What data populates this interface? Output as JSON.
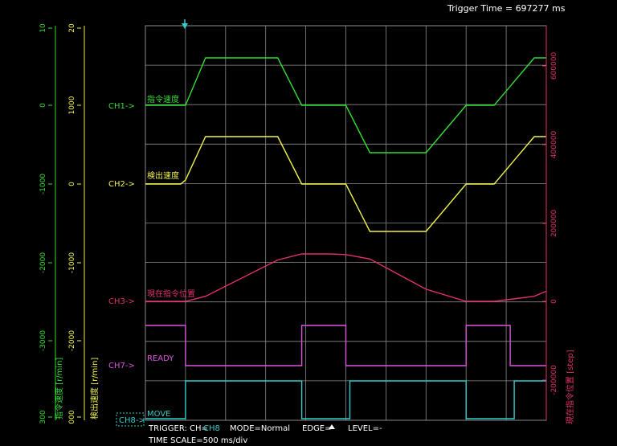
{
  "header": {
    "trigger_time": "Trigger Time = 697277 ms"
  },
  "colors": {
    "ch1": "#33dd33",
    "ch2": "#f2f24a",
    "ch3": "#e0306a",
    "ch7": "#dd55dd",
    "ch8": "#33cccc",
    "grid": "#8a8a8a"
  },
  "status": {
    "trigger_label": "TRIGGER: CH=",
    "trigger_ch": "CH8",
    "mode": "MODE=Normal",
    "edge_label": "EDGE=",
    "edge_icon": "rising-edge-icon",
    "level": "LEVEL=-",
    "time_scale": "TIME SCALE=500 ms/div"
  },
  "chart_data": {
    "type": "line",
    "x_unit": "ms",
    "x_range": [
      -500,
      4500
    ],
    "x_divisions": 10,
    "axes": {
      "ch1_speed": {
        "label": "指令速度 [r/min]",
        "ticks": [
          "10",
          "0",
          "-1000",
          "-2000",
          "-3000",
          "300"
        ]
      },
      "ch2_speed": {
        "label": "検出速度 [r/min]",
        "ticks": [
          "20",
          "1000",
          "0",
          "-1000",
          "-2000",
          "000"
        ]
      },
      "ch3_position": {
        "label": "現在指令位置 [step]",
        "ticks": [
          "600000",
          "400000",
          "200000",
          "0",
          "-200000"
        ]
      }
    },
    "channel_labels": [
      {
        "id": "CH1",
        "marker": "CH1->",
        "name": "指令速度"
      },
      {
        "id": "CH2",
        "marker": "CH2->",
        "name": "検出速度"
      },
      {
        "id": "CH3",
        "marker": "CH3->",
        "name": "現在指令位置"
      },
      {
        "id": "CH7",
        "marker": "CH7->",
        "name": "READY"
      },
      {
        "id": "CH8",
        "marker": "CH8->",
        "name": "MOVE"
      }
    ],
    "series": [
      {
        "name": "指令速度",
        "channel": "CH1",
        "unit": "r/min",
        "x": [
          -500,
          0,
          250,
          1150,
          1450,
          2000,
          2300,
          3000,
          3500,
          3850,
          4350,
          4500
        ],
        "y": [
          0,
          0,
          1200,
          1200,
          0,
          0,
          -1200,
          -1200,
          0,
          0,
          1200,
          1200
        ]
      },
      {
        "name": "検出速度",
        "channel": "CH2",
        "unit": "r/min",
        "x": [
          -500,
          -60,
          0,
          250,
          1150,
          1450,
          2000,
          2300,
          3000,
          3500,
          3850,
          4350,
          4500
        ],
        "y": [
          0,
          0,
          100,
          1200,
          1200,
          0,
          0,
          -1200,
          -1200,
          0,
          0,
          1200,
          1200
        ]
      },
      {
        "name": "現在指令位置",
        "channel": "CH3",
        "unit": "step",
        "x": [
          -500,
          0,
          250,
          1150,
          1450,
          1800,
          2000,
          2300,
          3000,
          3500,
          3850,
          4350,
          4500
        ],
        "y": [
          0,
          0,
          25000,
          205000,
          235000,
          235000,
          232000,
          210000,
          60000,
          0,
          0,
          25000,
          50000
        ]
      },
      {
        "name": "READY",
        "channel": "CH7",
        "unit": "logic",
        "x": [
          -500,
          0,
          0,
          1450,
          1450,
          2000,
          2000,
          3500,
          3500,
          4050,
          4050,
          4500
        ],
        "y": [
          1,
          1,
          0,
          0,
          1,
          1,
          0,
          0,
          1,
          1,
          0,
          0
        ]
      },
      {
        "name": "MOVE",
        "channel": "CH8",
        "unit": "logic",
        "x": [
          -500,
          0,
          0,
          1450,
          1450,
          2050,
          2050,
          3500,
          3500,
          4100,
          4100,
          4500
        ],
        "y": [
          0,
          0,
          1,
          1,
          0,
          0,
          1,
          1,
          0,
          0,
          1,
          1
        ]
      }
    ]
  }
}
